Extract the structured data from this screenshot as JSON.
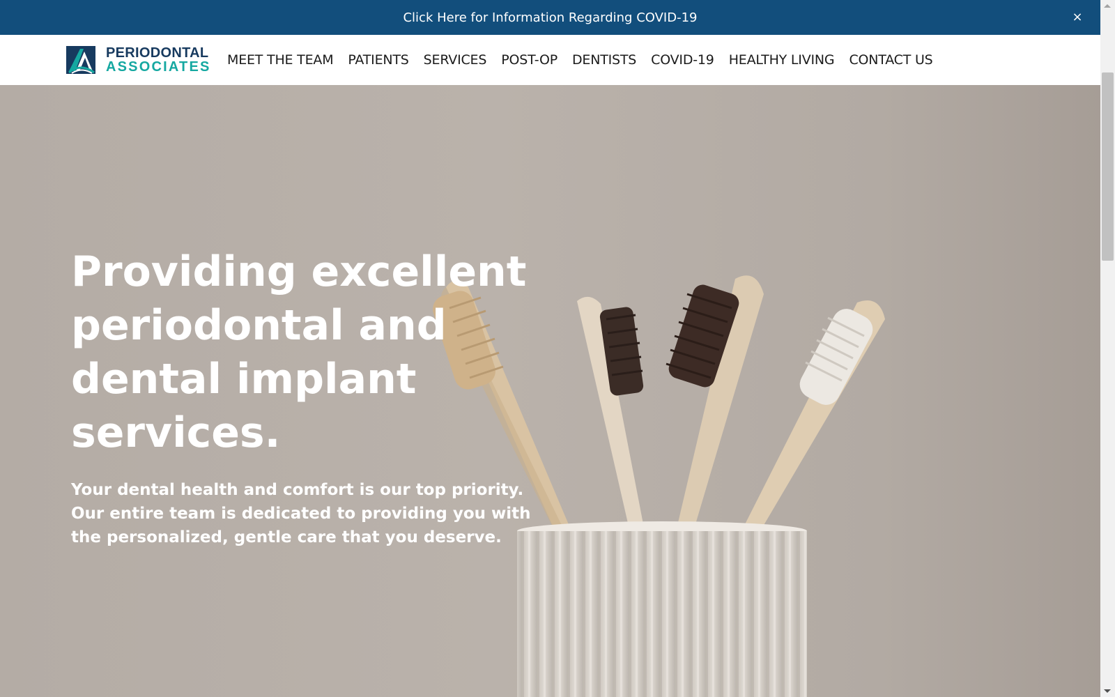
{
  "banner": {
    "text": "Click Here for Information Regarding COVID-19",
    "close_label": "×",
    "background": "#124e7c"
  },
  "logo": {
    "line1": "PERIODONTAL",
    "line2": "ASSOCIATES",
    "color_primary": "#173a5f",
    "color_accent": "#15a8a1"
  },
  "nav": {
    "items": [
      {
        "label": "MEET THE TEAM"
      },
      {
        "label": "PATIENTS"
      },
      {
        "label": "SERVICES"
      },
      {
        "label": "POST-OP"
      },
      {
        "label": "DENTISTS"
      },
      {
        "label": "COVID-19"
      },
      {
        "label": "HEALTHY LIVING"
      },
      {
        "label": "CONTACT US"
      }
    ]
  },
  "hero": {
    "title": "Providing excellent periodontal and dental implant services.",
    "subtitle": "Your dental health and comfort is our top priority. Our entire team is dedicated to providing you with the personalized, gentle care that you deserve.",
    "image": "toothbrushes-in-ribbed-cup"
  }
}
